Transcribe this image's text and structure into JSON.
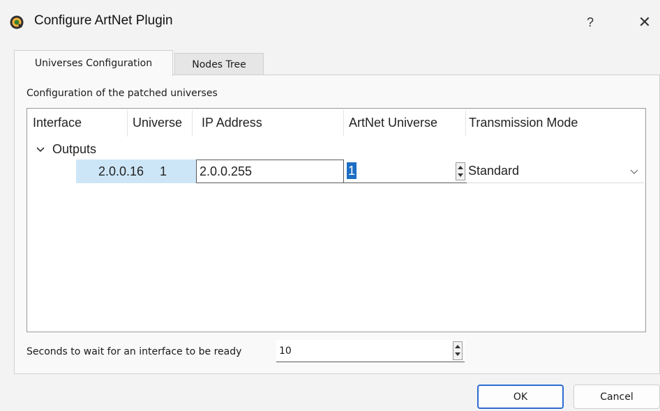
{
  "window": {
    "title": "Configure ArtNet Plugin",
    "help_label": "?",
    "close_label": "✕"
  },
  "tabs": [
    {
      "label": "Universes Configuration",
      "active": true
    },
    {
      "label": "Nodes Tree",
      "active": false
    }
  ],
  "universes": {
    "section_label": "Configuration of the patched universes",
    "columns": [
      "Interface",
      "Universe",
      "IP Address",
      "ArtNet Universe",
      "Transmission Mode"
    ],
    "group_label": "Outputs",
    "row": {
      "interface": "2.0.0.16",
      "universe": "1",
      "ip_address": "2.0.0.255",
      "artnet_universe": "1",
      "transmission_mode": "Standard"
    },
    "wait_label": "Seconds to wait for an interface to be ready",
    "wait_value": "10"
  },
  "buttons": {
    "ok": "OK",
    "cancel": "Cancel"
  },
  "colors": {
    "selection": "#cde6f7",
    "text_highlight": "#1c6ec4",
    "default_button_border": "#2d6bd1"
  },
  "icons": {
    "app": "qlc-plus-app-icon",
    "expand": "chevron-down-icon",
    "combo": "chevron-down-icon",
    "spin": "spin-arrows-icon"
  }
}
